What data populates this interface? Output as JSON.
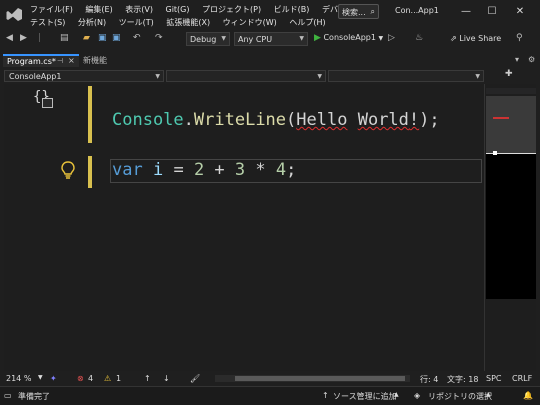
{
  "menu": {
    "row1": [
      "ファイル(F)",
      "編集(E)",
      "表示(V)",
      "Git(G)",
      "プロジェクト(P)",
      "ビルド(B)",
      "デバッグ(D)"
    ],
    "row2": [
      "テスト(S)",
      "分析(N)",
      "ツール(T)",
      "拡張機能(X)",
      "ウィンドウ(W)",
      "ヘルプ(H)"
    ]
  },
  "search": {
    "label": "検索..."
  },
  "window_title": "Con...App1",
  "toolbar": {
    "config": "Debug",
    "platform": "Any CPU",
    "run_label": "ConsoleApp1",
    "live_share": "Live Share"
  },
  "tabs": [
    {
      "label": "Program.cs*"
    },
    {
      "label": "新機能"
    }
  ],
  "navbar": {
    "project": "ConsoleApp1"
  },
  "code": {
    "line1": {
      "cls": "Console",
      "dot": ".",
      "method": "WriteLine",
      "paren": "(",
      "err1": "Hello",
      "space": " ",
      "err2": "World",
      "bang": "!",
      "close": ");"
    },
    "line2": {
      "kw": "var",
      "sp1": " ",
      "var": "i",
      "rest1": " = ",
      "n1": "2",
      "op1": " + ",
      "n2": "3",
      "op2": " * ",
      "n3": "4",
      "semi": ";"
    }
  },
  "editor_status": {
    "zoom": "214 %",
    "errors": "4",
    "warnings": "1",
    "line": "行: 4",
    "col": "文字: 18",
    "spc": "SPC",
    "crlf": "CRLF"
  },
  "statusbar": {
    "ready": "準備完了",
    "add_source": "ソース管理に追加",
    "select_repo": "リポジトリの選択"
  },
  "colors": {
    "accent": "#3794ff",
    "error": "#e03030",
    "warning": "#d8c04f"
  }
}
